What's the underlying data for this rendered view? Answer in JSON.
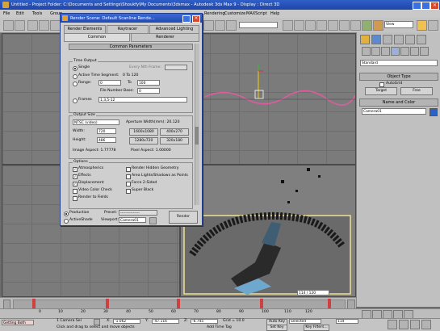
{
  "window": {
    "title": "Untitled     - Project Folder: C:\\Documents and Settings\\Shoukfy\\My Documents\\3dsmax     - Autodesk 3ds Max 9       - Display : Direct 3D"
  },
  "menu": [
    "File",
    "Edit",
    "Tools",
    "Group",
    "Views",
    "Create",
    "Modifiers",
    "reactor",
    "Animation",
    "Graph Editors",
    "Rendering",
    "Customize",
    "MAXScript",
    "Help"
  ],
  "toolbar": {
    "view_dropdown": "View",
    "named_sel": ""
  },
  "dialog": {
    "title": "Render Scene: Default Scanline Rende...",
    "tabs_row1": [
      "Render Elements",
      "Raytracer",
      "Advanced Lighting"
    ],
    "tabs_row2": [
      "Common",
      "Renderer"
    ],
    "rollout": "Common Parameters",
    "time_output": {
      "title": "Time Output",
      "single": "Single",
      "every_nth": "Every Nth Frame:",
      "active_segment": "Active Time Segment:",
      "active_range": "0 To 120",
      "range": "Range:",
      "range_from": "0",
      "range_to_label": "To",
      "range_to": "100",
      "file_number_base": "File Number Base:",
      "file_number_value": "0",
      "frames": "Frames",
      "frames_value": "1,3,5-12"
    },
    "output_size": {
      "title": "Output Size",
      "preset": "NTSC (video)",
      "aperture": "Aperture Width(mm): 20.120",
      "width_label": "Width:",
      "width": "720",
      "height_label": "Height:",
      "height": "486",
      "presets": [
        "1600x1080",
        "400x270",
        "1280x720",
        "320x180"
      ],
      "image_aspect": "Image Aspect: 1.77778",
      "pixel_aspect": "Pixel Aspect: 1.00000"
    },
    "options": {
      "title": "Options",
      "left": [
        {
          "label": "Atmospherics",
          "checked": true
        },
        {
          "label": "Effects",
          "checked": true
        },
        {
          "label": "Displacement",
          "checked": true
        },
        {
          "label": "Video Color Check",
          "checked": false
        },
        {
          "label": "Render to Fields",
          "checked": false
        }
      ],
      "right": [
        {
          "label": "Render Hidden Geometry",
          "checked": false
        },
        {
          "label": "Area Lights/Shadows as Points",
          "checked": false
        },
        {
          "label": "Force 2-Sided",
          "checked": false
        },
        {
          "label": "Super Black",
          "checked": false
        }
      ]
    },
    "bottom": {
      "production": "Production",
      "activeshade": "ActiveShade",
      "preset_label": "Preset:",
      "preset_value": "---------------",
      "viewport_label": "Viewport:",
      "viewport_value": "Camera01",
      "render_button": "Render"
    }
  },
  "viewports": [
    {
      "name": "top-left",
      "label": ""
    },
    {
      "name": "top-right",
      "label": ""
    },
    {
      "name": "bottom-left",
      "label": ""
    },
    {
      "name": "camera",
      "label": ""
    }
  ],
  "command_panel": {
    "dropdown": "Standard",
    "object_type": "Object Type",
    "autogrid": "AutoGrid",
    "target_button": "Target",
    "free_button": "Free",
    "name_color": "Name and Color",
    "name_value": "Camera01"
  },
  "timeline": {
    "slider": "114 / 120",
    "ticks": [
      "0",
      "10",
      "20",
      "30",
      "40",
      "50",
      "60",
      "70",
      "80",
      "90",
      "100",
      "110",
      "120"
    ]
  },
  "status": {
    "selected": "1 Camera Sel",
    "x_label": "X:",
    "x": "-1.062",
    "y_label": "Y:",
    "y": "-47.116",
    "z_label": "Z:",
    "z": "-6.745",
    "grid": "Grid = 10.0",
    "autokey": "Auto Key",
    "autokey_dropdown": "Selected",
    "setkey": "Set Key",
    "key_filters": "Key Filters...",
    "frame_value": "114",
    "prompt": "Click and drag to select and move objects",
    "add_time_tag": "Add Time Tag",
    "maxscript": "Getting Both"
  },
  "colors": {
    "title_bar": "#2149b0",
    "selection_box": "#f0e090",
    "spline": "#e45aa0"
  }
}
